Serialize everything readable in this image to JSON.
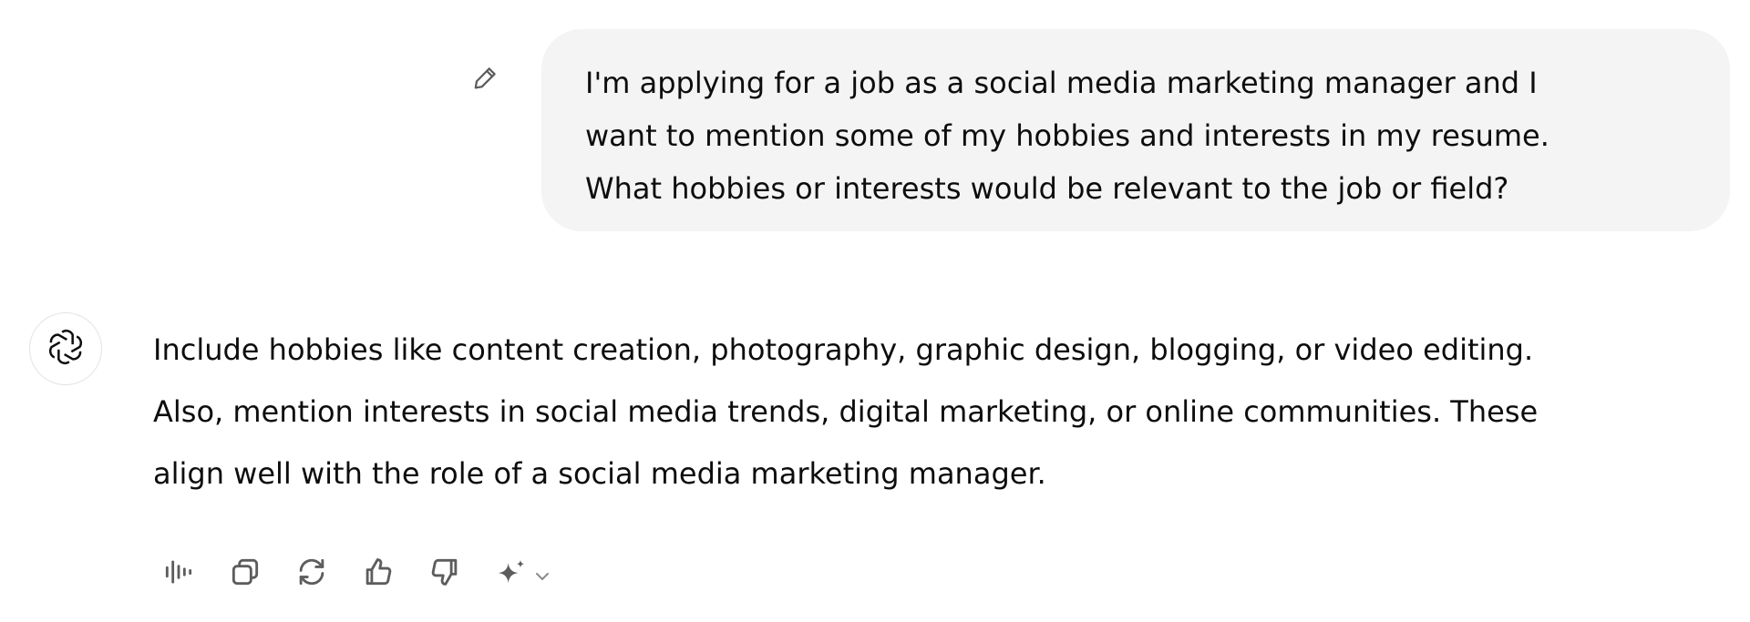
{
  "conversation": {
    "user_message": {
      "text": "I'm applying for a job as a social media marketing manager and I\nwant to mention some of my hobbies and interests in my resume.\nWhat hobbies or interests would be relevant to the job or field?",
      "edit_icon": "pencil-icon"
    },
    "assistant_message": {
      "avatar_icon": "openai-logo-icon",
      "text": "Include hobbies like content creation, photography, graphic design, blogging, or video editing.\nAlso, mention interests in social media trends, digital marketing, or online communities. These\nalign well with the role of a social media marketing manager."
    },
    "toolbar": {
      "icons": [
        "read-aloud-icon",
        "copy-icon",
        "regenerate-icon",
        "thumbs-up-icon",
        "thumbs-down-icon",
        "sparkle-icon",
        "chevron-down-icon"
      ]
    }
  },
  "colors": {
    "user_bubble_bg": "#f4f4f4",
    "text": "#0d0d0d",
    "icon": "#5d5d5d"
  }
}
